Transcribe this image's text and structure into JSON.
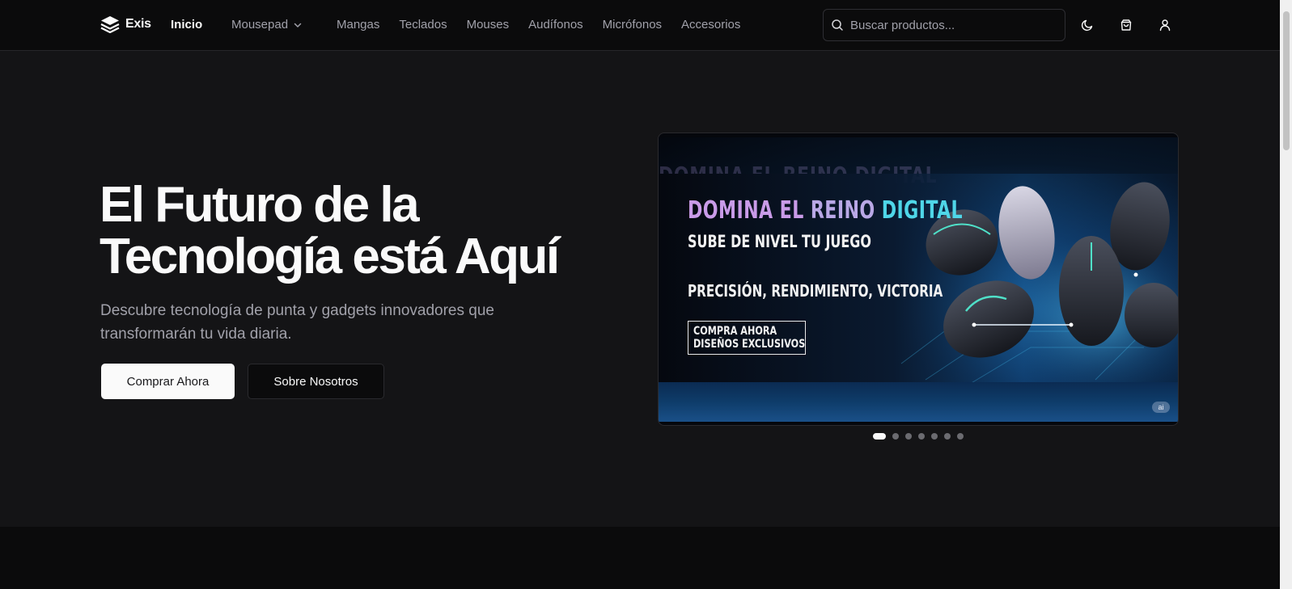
{
  "brand": {
    "name": "Exis"
  },
  "nav": {
    "home": "Inicio",
    "dropdown": "Mousepad",
    "links": [
      "Mangas",
      "Teclados",
      "Mouses",
      "Audífonos",
      "Micrófonos",
      "Accesorios"
    ]
  },
  "search": {
    "placeholder": "Buscar productos..."
  },
  "header_icons": [
    "moon-icon",
    "shopping-bag-icon",
    "user-icon"
  ],
  "hero": {
    "title_line1": "El Futuro de la",
    "title_line2": "Tecnología está Aquí",
    "subtitle": "Descubre tecnología de punta y gadgets innovadores que transformarán tu vida diaria.",
    "primary_button": "Comprar Ahora",
    "secondary_button": "Sobre Nosotros"
  },
  "carousel": {
    "slide": {
      "ghost": "DOMINA EL REINO DIGITAL",
      "headline_w1": "DOMINA EL",
      "headline_w2": "REINO",
      "headline_w3": "DIGITAL",
      "subheadline": "SUBE DE NIVEL TU JUEGO",
      "tagline": "PRECISIÓN, RENDIMIENTO, VICTORIA",
      "cta_line1": "COMPRA AHORA",
      "cta_line2": "DISEÑOS EXCLUSIVOS",
      "badge": "ai"
    },
    "slide_count": 7,
    "active_index": 0
  },
  "colors": {
    "background": "#141416",
    "header": "#0b0b0c",
    "text": "#fafafa",
    "muted": "#a1a1aa",
    "accent_cyan": "#4fd6e8",
    "accent_purple": "#c99be8"
  }
}
